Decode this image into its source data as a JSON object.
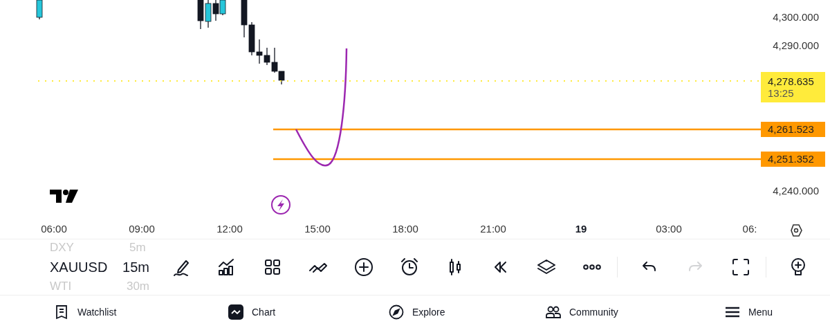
{
  "chart": {
    "price_ticks": [
      {
        "label": "4,300.000"
      },
      {
        "label": "4,290.000"
      },
      {
        "label": "4,240.000"
      }
    ],
    "current_price": {
      "price": "4,278.635",
      "countdown": "13:25",
      "color": "#ffeb3b"
    },
    "price_lines": [
      {
        "price": "4,261.523",
        "color": "#ff9800"
      },
      {
        "price": "4,251.352",
        "color": "#ff9800"
      }
    ],
    "time_ticks": [
      {
        "label": "06:00",
        "bold": false
      },
      {
        "label": "09:00",
        "bold": false
      },
      {
        "label": "12:00",
        "bold": false
      },
      {
        "label": "15:00",
        "bold": false
      },
      {
        "label": "18:00",
        "bold": false
      },
      {
        "label": "21:00",
        "bold": false
      },
      {
        "label": "19",
        "bold": true
      },
      {
        "label": "03:00",
        "bold": false
      },
      {
        "label": "06:",
        "bold": false
      }
    ]
  },
  "symbols": [
    {
      "symbol": "DXY",
      "interval": "5m",
      "selected": false
    },
    {
      "symbol": "XAUUSD",
      "interval": "15m",
      "selected": true
    },
    {
      "symbol": "WTI",
      "interval": "30m",
      "selected": false
    }
  ],
  "toolbar": [
    {
      "kind": "draw",
      "disabled": false
    },
    {
      "kind": "indicators",
      "disabled": false
    },
    {
      "kind": "layout",
      "disabled": false
    },
    {
      "kind": "compare",
      "disabled": false
    },
    {
      "kind": "add",
      "disabled": false
    },
    {
      "kind": "alert",
      "disabled": false
    },
    {
      "kind": "candles",
      "disabled": false
    },
    {
      "kind": "replay",
      "disabled": false
    },
    {
      "kind": "layers",
      "disabled": false
    },
    {
      "kind": "more",
      "disabled": false
    },
    {
      "kind": "undo",
      "disabled": false
    },
    {
      "kind": "redo",
      "disabled": true
    },
    {
      "kind": "fullscreen",
      "disabled": false
    },
    {
      "kind": "ideas",
      "disabled": false
    }
  ],
  "nav": [
    {
      "label": "Watchlist",
      "kind": "watchlist",
      "selected": false
    },
    {
      "label": "Chart",
      "kind": "chart",
      "selected": true
    },
    {
      "label": "Explore",
      "kind": "explore",
      "selected": false
    },
    {
      "label": "Community",
      "kind": "community",
      "selected": false
    },
    {
      "label": "Menu",
      "kind": "menu",
      "selected": false
    }
  ]
}
